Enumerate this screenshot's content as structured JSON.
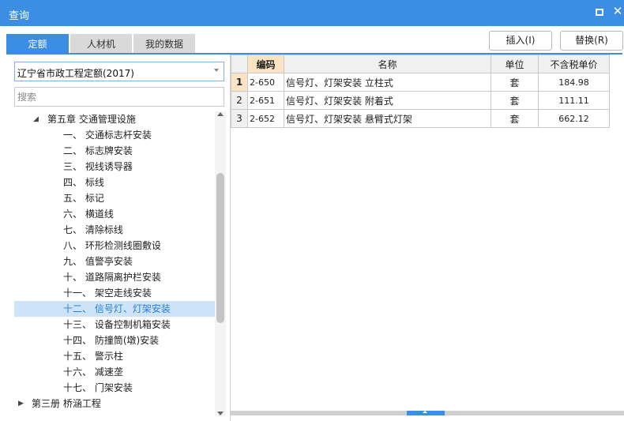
{
  "window": {
    "title": "查询"
  },
  "tabs": [
    {
      "label": "定额",
      "active": true
    },
    {
      "label": "人材机",
      "active": false
    },
    {
      "label": "我的数据",
      "active": false
    }
  ],
  "toolbar": {
    "insert_label": "插入(I)",
    "replace_label": "替换(R)"
  },
  "library": {
    "selected": "辽宁省市政工程定额(2017)"
  },
  "search": {
    "placeholder": "搜索"
  },
  "tree": {
    "chapter": "第五章 交通管理设施",
    "items": [
      "一、 交通标志杆安装",
      "二、 标志牌安装",
      "三、 视线诱导器",
      "四、 标线",
      "五、 标记",
      "六、 横道线",
      "七、 清除标线",
      "八、 环形检测线圈敷设",
      "九、 值警亭安装",
      "十、 道路隔离护栏安装",
      "十一、 架空走线安装",
      "十二、 信号灯、灯架安装",
      "十三、 设备控制机箱安装",
      "十四、 防撞筒(墩)安装",
      "十五、 警示柱",
      "十六、 减速垄",
      "十七、 门架安装"
    ],
    "selected_index": 11,
    "next_volume": "第三册 桥涵工程"
  },
  "table": {
    "columns": [
      "编码",
      "名称",
      "单位",
      "不含税单价"
    ],
    "rows": [
      {
        "num": "1",
        "code": "2-650",
        "name": "信号灯、灯架安装 立柱式",
        "unit": "套",
        "price": "184.98"
      },
      {
        "num": "2",
        "code": "2-651",
        "name": "信号灯、灯架安装 附着式",
        "unit": "套",
        "price": "111.11"
      },
      {
        "num": "3",
        "code": "2-652",
        "name": "信号灯、灯架安装 悬臂式灯架",
        "unit": "套",
        "price": "662.12"
      }
    ]
  },
  "colors": {
    "accent": "#3b8ee4",
    "highlight": "#fbe3c4",
    "selected_row": "#cde3f7"
  }
}
